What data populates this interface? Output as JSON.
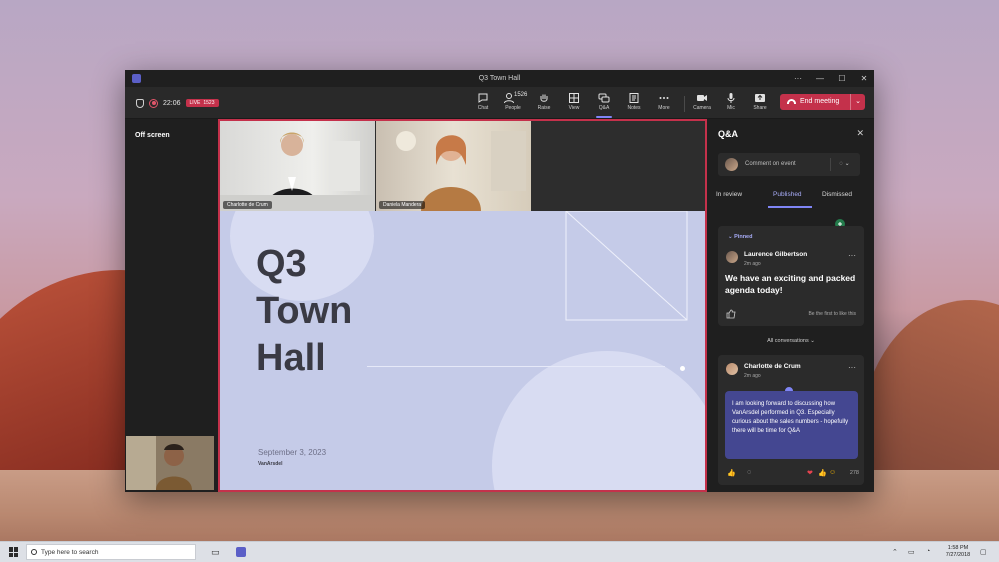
{
  "window": {
    "title": "Q3 Town Hall",
    "more_glyph": "···",
    "minimize_glyph": "—",
    "maximize_glyph": "☐",
    "close_glyph": "✕"
  },
  "meeting": {
    "timer": "22:06",
    "live_label": "LIVE",
    "viewer_count": "1523"
  },
  "toolbar": {
    "chat": "Chat",
    "people": "People",
    "people_count": "1526",
    "raise": "Raise",
    "view": "View",
    "qa": "Q&A",
    "notes": "Notes",
    "more": "More",
    "camera": "Camera",
    "mic": "Mic",
    "share": "Share",
    "end_meeting": "End meeting",
    "end_chevron": "⌄"
  },
  "left_pane": {
    "off_screen": "Off screen"
  },
  "participants": [
    {
      "name": "Charlotte de Crum"
    },
    {
      "name": "Daniela Mandera"
    }
  ],
  "slide": {
    "title_lines": [
      "Q3",
      "Town",
      "Hall"
    ],
    "date": "September 3, 2023",
    "logo": "VanArsdel"
  },
  "qa": {
    "header": "Q&A",
    "close_glyph": "✕",
    "comment_placeholder": "Comment on event",
    "tabs": [
      "In review",
      "Published",
      "Dismissed"
    ],
    "active_tab": "Published",
    "pinned_label": "Pinned",
    "pinned_chevron": "⌄",
    "card1": {
      "author": "Laurence Gilbertson",
      "time": "2m ago",
      "question": "We have an exciting and packed agenda today!",
      "like_prompt": "Be the first to like this",
      "more_glyph": "···"
    },
    "all_conversations": "All conversations",
    "all_conv_chevron": "⌄",
    "card2": {
      "author": "Charlotte de Crum",
      "time": "2m ago",
      "text": "I am looking forward to discussing how VanArsdel performed in Q3. Especially curious about the sales numbers - hopefully there will be time for Q&A",
      "reaction_count": "278",
      "more_glyph": "···"
    }
  },
  "taskbar": {
    "search_placeholder": "Type here to search",
    "time": "1:58 PM",
    "date": "7/27/2018"
  },
  "colors": {
    "accent": "#7f85f5",
    "end_meeting": "#c4314b",
    "stage_border": "#c4314b",
    "slide_bg": "#c5cbe8",
    "bubble": "#444791"
  },
  "icons": {
    "shield": "shield-icon",
    "record": "record-icon",
    "chat": "chat-icon",
    "people": "people-icon",
    "raise": "hand-icon",
    "view": "grid-icon",
    "qa": "qa-icon",
    "notes": "notes-icon",
    "more": "more-icon",
    "camera": "camera-icon",
    "mic": "mic-icon",
    "share": "share-icon",
    "end": "phone-hangup-icon"
  }
}
